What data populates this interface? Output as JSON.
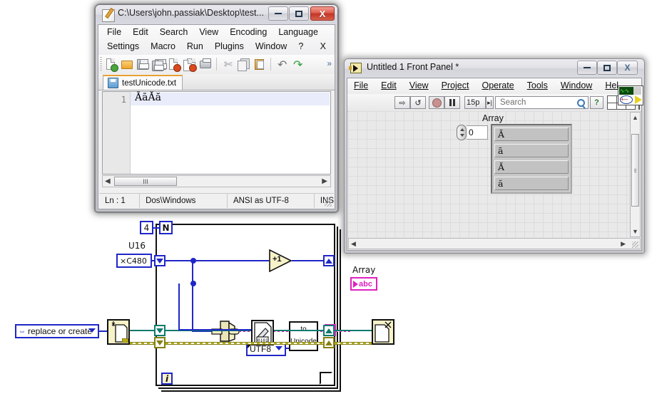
{
  "notepad": {
    "title": "C:\\Users\\john.passiak\\Desktop\\test...",
    "icon": "notepad-plus-icon",
    "menus_row1": [
      "File",
      "Edit",
      "Search",
      "View",
      "Encoding",
      "Language"
    ],
    "menus_row2": [
      "Settings",
      "Macro",
      "Run",
      "Plugins",
      "Window",
      "?"
    ],
    "close_menu_label": "X",
    "toolbar_icons": [
      "new-file-icon",
      "open-file-icon",
      "save-icon",
      "save-all-icon",
      "close-file-icon",
      "close-all-icon",
      "print-icon",
      "cut-icon",
      "copy-icon",
      "paste-icon",
      "undo-icon",
      "redo-icon",
      "overflow-chevron-icon"
    ],
    "tab": {
      "label": "testUnicode.txt",
      "icon": "save-tab-icon"
    },
    "editor": {
      "line_number": "1",
      "line_text": "ĀāĂă"
    },
    "hscroll_thumb_glyph": "III",
    "statusbar": [
      "Ln : 1",
      "Dos\\Windows",
      "ANSI as UTF-8",
      "INS"
    ],
    "window_buttons": {
      "minimize": "minimize-icon",
      "maximize": "maximize-icon",
      "close": "X"
    }
  },
  "labview_fp": {
    "title": "Untitled 1 Front Panel *",
    "icon": "labview-vi-icon",
    "menus": [
      "File",
      "Edit",
      "View",
      "Project",
      "Operate",
      "Tools",
      "Window",
      "Hel"
    ],
    "toolbar": {
      "run_icon": "run-arrow-icon",
      "run_continuous_icon": "run-continuously-icon",
      "abort_icon": "abort-execution-icon",
      "pause_icon": "pause-icon",
      "font_size": "15p",
      "font_dropdown_icon": "text-settings-dropdown-icon",
      "search_placeholder": "Search",
      "search_icon": "magnifier-icon",
      "help_icon": "context-help-icon",
      "align_grid_icon": "align-objects-grid-icon",
      "vi_glyph_icon": "vi-snippet-icon"
    },
    "array_control": {
      "label": "Array",
      "index_value": "0",
      "index_spinner_icon": "increment-decrement-icon",
      "elements": [
        "Ā",
        "ā",
        "Ă",
        "ă"
      ]
    },
    "window_buttons": {
      "minimize": "minimize-icon",
      "maximize": "maximize-icon",
      "close": "X"
    }
  },
  "block_diagram": {
    "loop_count": {
      "value": "4",
      "terminal": "N"
    },
    "iteration_terminal": "i",
    "constant": {
      "label": "U16",
      "value": "×C480",
      "representation": "U16"
    },
    "increment_label": "+1",
    "type_cast_icon": "type-cast-icon",
    "enum_constant": {
      "value": "UTF8",
      "dropdown_icon": "enum-dropdown-icon"
    },
    "to_unicode_vi": {
      "line1": "to",
      "line2": "Unicode"
    },
    "indicator": {
      "label": "Array",
      "terminal_text": "abc",
      "terminal_icon": "string-array-indicator-icon"
    },
    "file_mode": {
      "value": "replace or create",
      "dropdown_icon": "enum-dropdown-icon",
      "arrows_icon": "enum-arrows-icon"
    },
    "open_file_vi": "open-create-replace-file-icon",
    "write_file_vi": "write-to-text-file-icon",
    "close_file_vi": "close-file-icon",
    "array_index_icon": "index-array-icon"
  },
  "colors": {
    "wire_blue": "#1f27c8",
    "wire_string_pink": "#e020c0",
    "wire_error_olive": "#857f12",
    "wire_refnum_teal": "#0f7a6e",
    "vi_body": "#f7f2c8",
    "npp_tab_accent": "#e8a033"
  }
}
